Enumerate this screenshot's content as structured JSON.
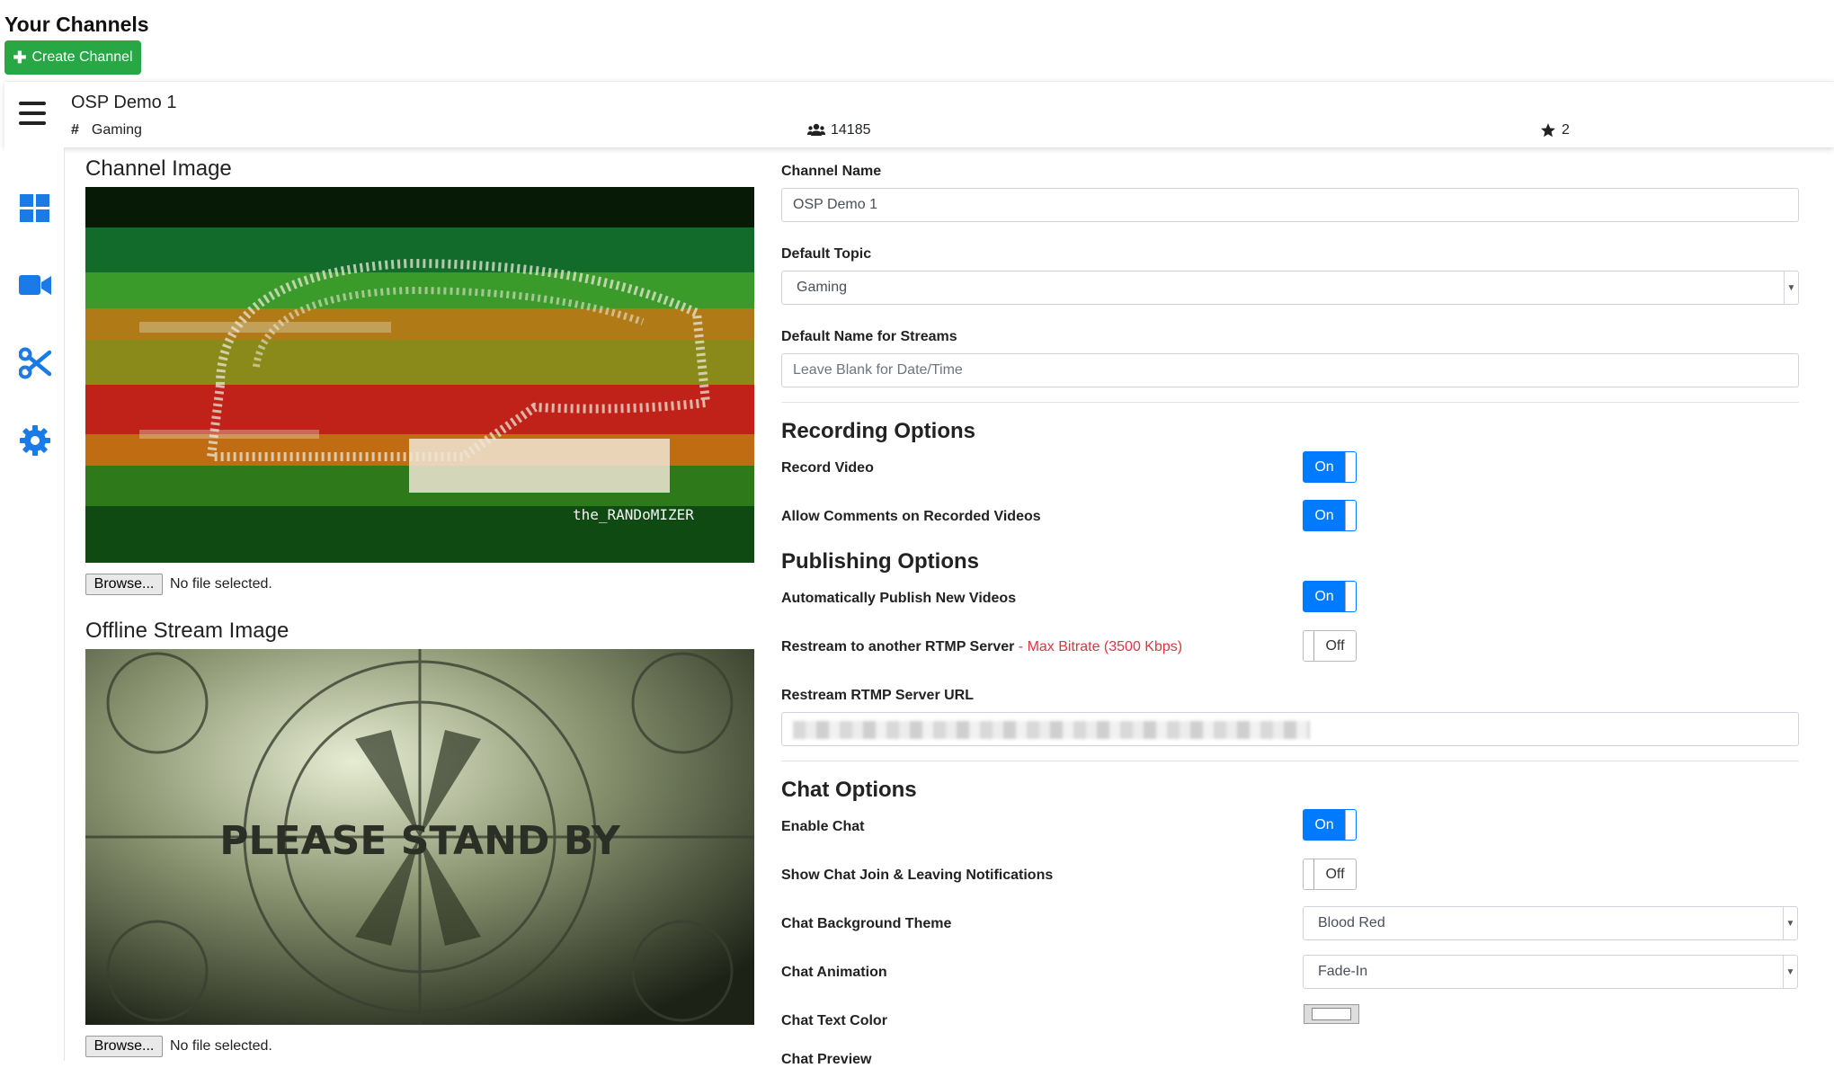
{
  "header": {
    "title": "Your Channels",
    "create_button": "Create Channel"
  },
  "channel": {
    "name": "OSP Demo 1",
    "topic": "Gaming",
    "viewers": "14185",
    "stars": "2"
  },
  "sidebar": {
    "icons": [
      "dashboard-icon",
      "video-camera-icon",
      "scissors-icon",
      "gear-icon"
    ]
  },
  "images": {
    "channel_image_title": "Channel Image",
    "channel_image_caption": "the_RANDoMIZER",
    "offline_image_title": "Offline Stream Image",
    "offline_image_caption": "PLEASE STAND BY",
    "browse_label": "Browse...",
    "no_file_text": "No file selected."
  },
  "form": {
    "channel_name_label": "Channel Name",
    "channel_name_value": "OSP Demo 1",
    "default_topic_label": "Default Topic",
    "default_topic_value": "Gaming",
    "default_stream_name_label": "Default Name for Streams",
    "default_stream_name_placeholder": "Leave Blank for Date/Time",
    "recording_heading": "Recording Options",
    "record_video_label": "Record Video",
    "allow_comments_label": "Allow Comments on Recorded Videos",
    "publishing_heading": "Publishing Options",
    "auto_publish_label": "Automatically Publish New Videos",
    "restream_label": "Restream to another RTMP Server",
    "restream_note": " - Max Bitrate (3500 Kbps)",
    "restream_url_label": "Restream RTMP Server URL",
    "chat_heading": "Chat Options",
    "enable_chat_label": "Enable Chat",
    "join_leave_label": "Show Chat Join & Leaving Notifications",
    "chat_theme_label": "Chat Background Theme",
    "chat_theme_value": "Blood Red",
    "chat_animation_label": "Chat Animation",
    "chat_animation_value": "Fade-In",
    "chat_text_color_label": "Chat Text Color",
    "cutoff_label": "Chat Preview"
  },
  "toggles": {
    "on": "On",
    "off": "Off"
  },
  "colors": {
    "primary": "#007bff",
    "success": "#28a745",
    "danger": "#dc3545"
  }
}
